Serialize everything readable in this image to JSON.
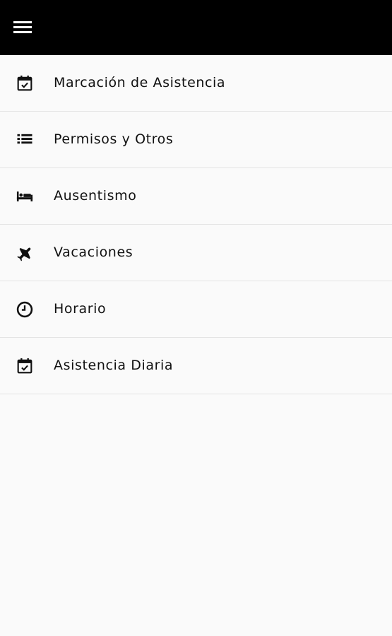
{
  "header": {
    "menu_icon": "hamburger-menu-icon",
    "background": "#000000"
  },
  "menu": {
    "items": [
      {
        "label": "Marcación de Asistencia",
        "icon": "calendar-check-icon"
      },
      {
        "label": "Permisos y Otros",
        "icon": "list-icon"
      },
      {
        "label": "Ausentismo",
        "icon": "bed-icon"
      },
      {
        "label": "Vacaciones",
        "icon": "airplane-icon"
      },
      {
        "label": "Horario",
        "icon": "clock-icon"
      },
      {
        "label": "Asistencia Diaria",
        "icon": "calendar-check-icon"
      }
    ]
  }
}
